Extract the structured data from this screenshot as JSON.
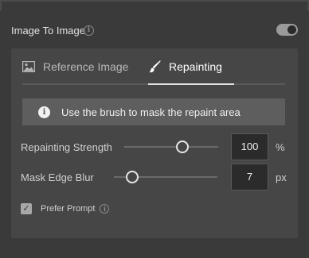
{
  "header": {
    "title": "Image To Image",
    "toggle_on": true
  },
  "tabs": [
    {
      "label": "Reference Image",
      "icon": "image-icon",
      "active": false
    },
    {
      "label": "Repainting",
      "icon": "brush-icon",
      "active": true
    }
  ],
  "banner": {
    "icon": "info-icon",
    "text": "Use the brush to mask the repaint area"
  },
  "repainting_strength": {
    "label": "Repainting Strength",
    "value": "100",
    "unit": "%",
    "slider_fraction": 0.62
  },
  "mask_edge_blur": {
    "label": "Mask Edge Blur",
    "value": "7",
    "unit": "px",
    "slider_fraction": 0.18
  },
  "prefer_prompt": {
    "label": "Prefer Prompt",
    "checked": true
  },
  "colors": {
    "background": "#3a3a3a",
    "panel": "#464646",
    "banner": "#5e5e5e",
    "input": "#2b2b2b"
  }
}
